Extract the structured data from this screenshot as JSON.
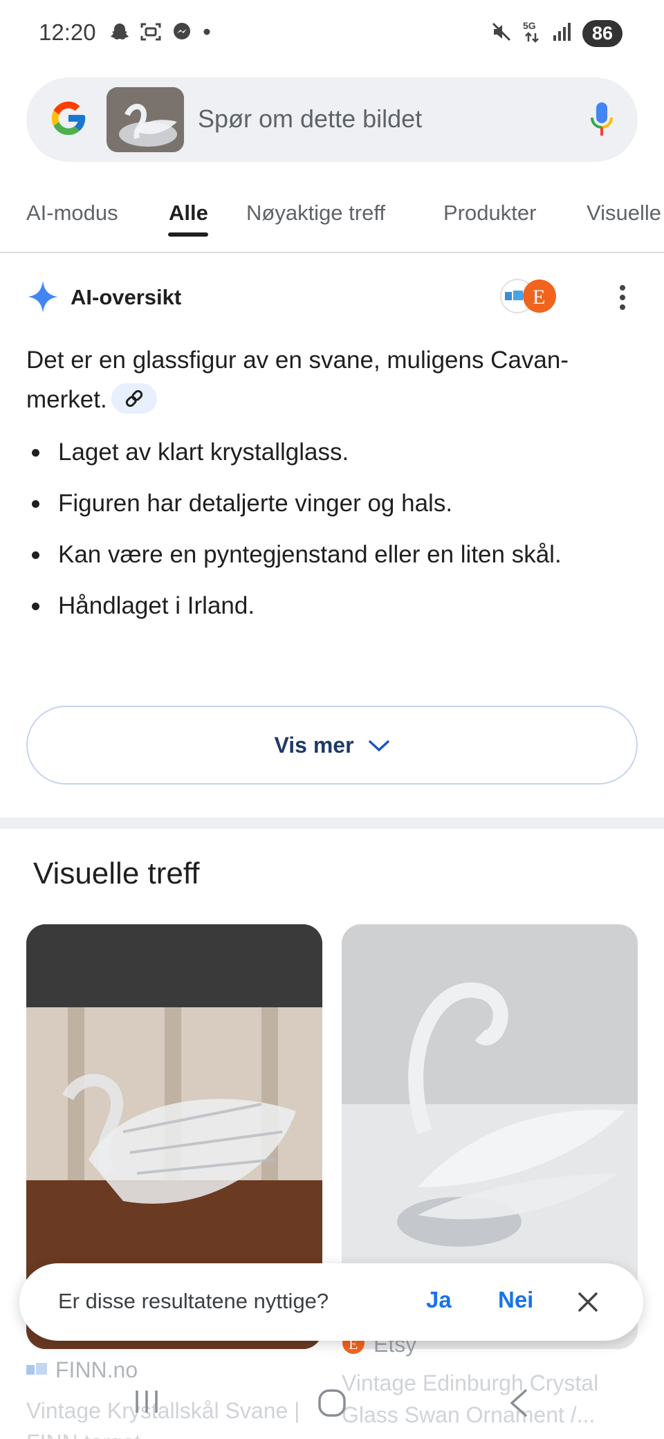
{
  "status_bar": {
    "time": "12:20",
    "battery": "86",
    "network": "5G",
    "icons": [
      "snapchat-icon",
      "screenshot-icon",
      "messenger-icon",
      "dot-icon",
      "mute-icon",
      "5g-icon",
      "signal-icon",
      "battery-icon"
    ]
  },
  "search": {
    "placeholder": "Spør om dette bildet",
    "icons": [
      "google-logo",
      "mic-icon"
    ]
  },
  "tabs": [
    {
      "label": "AI-modus",
      "active": false
    },
    {
      "label": "Alle",
      "active": true
    },
    {
      "label": "Nøyaktige treff",
      "active": false
    },
    {
      "label": "Produkter",
      "active": false
    },
    {
      "label": "Visuelle",
      "active": false
    }
  ],
  "ai_overview": {
    "title": "AI-oversikt",
    "summary": "Det er en glassfigur av en svane, muligens Cavan-merket.",
    "bullets": [
      "Laget av klart krystallglass.",
      "Figuren har detaljerte vinger og hals.",
      "Kan være en pyntegjenstand eller en liten skål.",
      "Håndlaget i Irland."
    ],
    "show_more": "Vis mer"
  },
  "visual_matches": {
    "heading": "Visuelle treff",
    "cards": [
      {
        "source": "FINN.no",
        "title": "Vintage Krystallskål Svane | FINN.torget"
      },
      {
        "source": "Etsy",
        "title": "Vintage Edinburgh Crystal Glass Swan Ornament /..."
      }
    ]
  },
  "feedback": {
    "question": "Er disse resultatene nyttige?",
    "yes": "Ja",
    "no": "Nei"
  },
  "colors": {
    "accent": "#1a73e8",
    "search_bg": "#eef0f3",
    "etsy": "#f1641e"
  }
}
